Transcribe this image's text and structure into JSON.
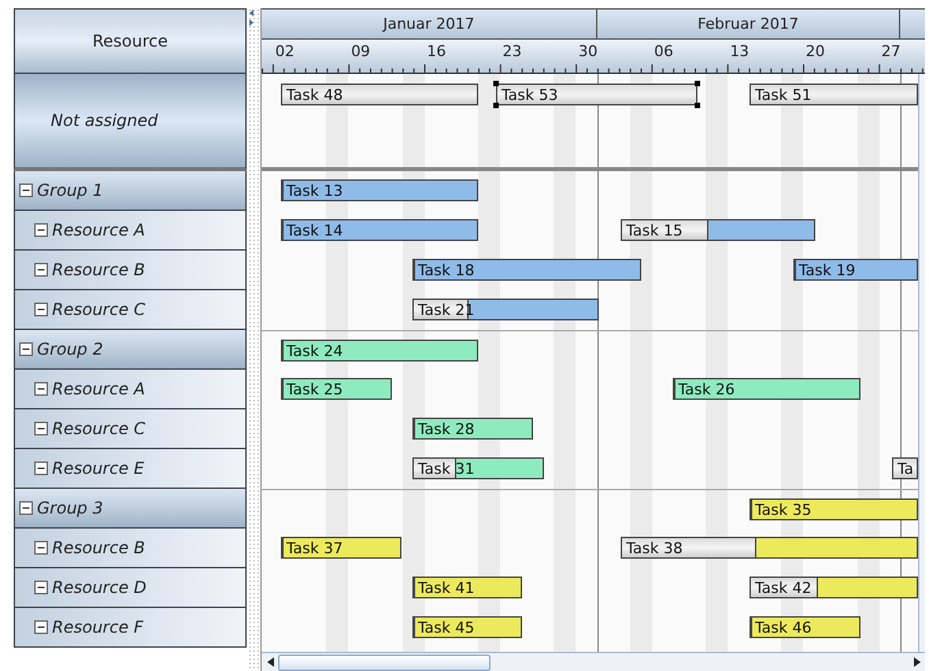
{
  "header": {
    "resource_label": "Resource",
    "months": [
      "Januar 2017",
      "Februar 2017"
    ],
    "weeks": [
      "02",
      "09",
      "16",
      "23",
      "30",
      "06",
      "13",
      "20",
      "27"
    ]
  },
  "unassigned": {
    "label": "Not assigned",
    "tasks": [
      {
        "label": "Task 48",
        "selected": false
      },
      {
        "label": "Task 53",
        "selected": true
      },
      {
        "label": "Task 51",
        "selected": false
      }
    ]
  },
  "groups": [
    {
      "label": "Group 1",
      "expanded": true,
      "color": "#8fbbe9",
      "tasks": [
        {
          "label": "Task 13",
          "level": 1,
          "selected": false
        }
      ],
      "resources": [
        {
          "label": "Resource A",
          "expanded": true,
          "tasks": [
            {
              "label": "Task 14",
              "level": 1,
              "selected": false
            },
            {
              "label": "Task 15",
              "level": 0.56,
              "selected": false
            }
          ]
        },
        {
          "label": "Resource B",
          "expanded": true,
          "tasks": [
            {
              "label": "Task 18",
              "level": 1,
              "selected": false
            },
            {
              "label": "Task 19",
              "level": 1,
              "selected": false
            }
          ]
        },
        {
          "label": "Resource C",
          "expanded": true,
          "tasks": [
            {
              "label": "Task 21",
              "level": 0.71,
              "selected": false
            }
          ]
        }
      ]
    },
    {
      "label": "Group 2",
      "expanded": true,
      "color": "#8eebc0",
      "tasks": [
        {
          "label": "Task 24",
          "level": 1,
          "selected": false
        }
      ],
      "resources": [
        {
          "label": "Resource A",
          "expanded": true,
          "tasks": [
            {
              "label": "Task 25",
              "level": 1,
              "selected": false
            },
            {
              "label": "Task 26",
              "level": 1,
              "selected": false
            }
          ]
        },
        {
          "label": "Resource C",
          "expanded": true,
          "tasks": [
            {
              "label": "Task 28",
              "level": 1,
              "selected": false
            }
          ]
        },
        {
          "label": "Resource E",
          "expanded": true,
          "tasks": [
            {
              "label": "Task 31",
              "level": 0.68,
              "selected": false
            },
            {
              "label": "Ta",
              "selected": false
            }
          ]
        }
      ]
    },
    {
      "label": "Group 3",
      "expanded": true,
      "color": "#ecea5c",
      "tasks": [
        {
          "label": "Task 35",
          "level": 1,
          "selected": false
        }
      ],
      "resources": [
        {
          "label": "Resource B",
          "expanded": true,
          "tasks": [
            {
              "label": "Task 37",
              "level": 1,
              "selected": false
            },
            {
              "label": "Task 38",
              "level": 0.55,
              "selected": false
            }
          ]
        },
        {
          "label": "Resource D",
          "expanded": true,
          "tasks": [
            {
              "label": "Task 41",
              "level": 1,
              "selected": false
            },
            {
              "label": "Task 42",
              "level": 0.6,
              "selected": false
            }
          ]
        },
        {
          "label": "Resource F",
          "expanded": true,
          "tasks": [
            {
              "label": "Task 45",
              "level": 1,
              "selected": false
            },
            {
              "label": "Task 46",
              "level": 1,
              "selected": false
            }
          ]
        }
      ]
    }
  ]
}
